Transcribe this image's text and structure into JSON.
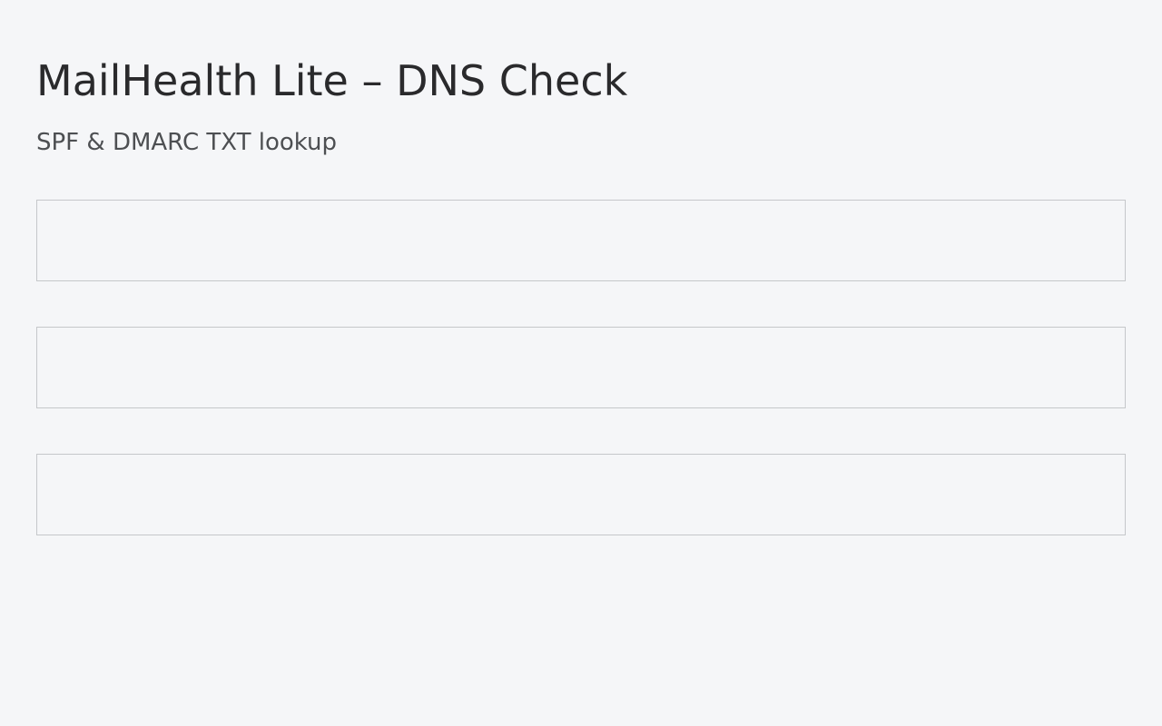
{
  "header": {
    "title": "MailHealth Lite – DNS Check",
    "subtitle": "SPF & DMARC TXT lookup"
  },
  "panels": [
    {
      "content": ""
    },
    {
      "content": ""
    },
    {
      "content": ""
    }
  ]
}
